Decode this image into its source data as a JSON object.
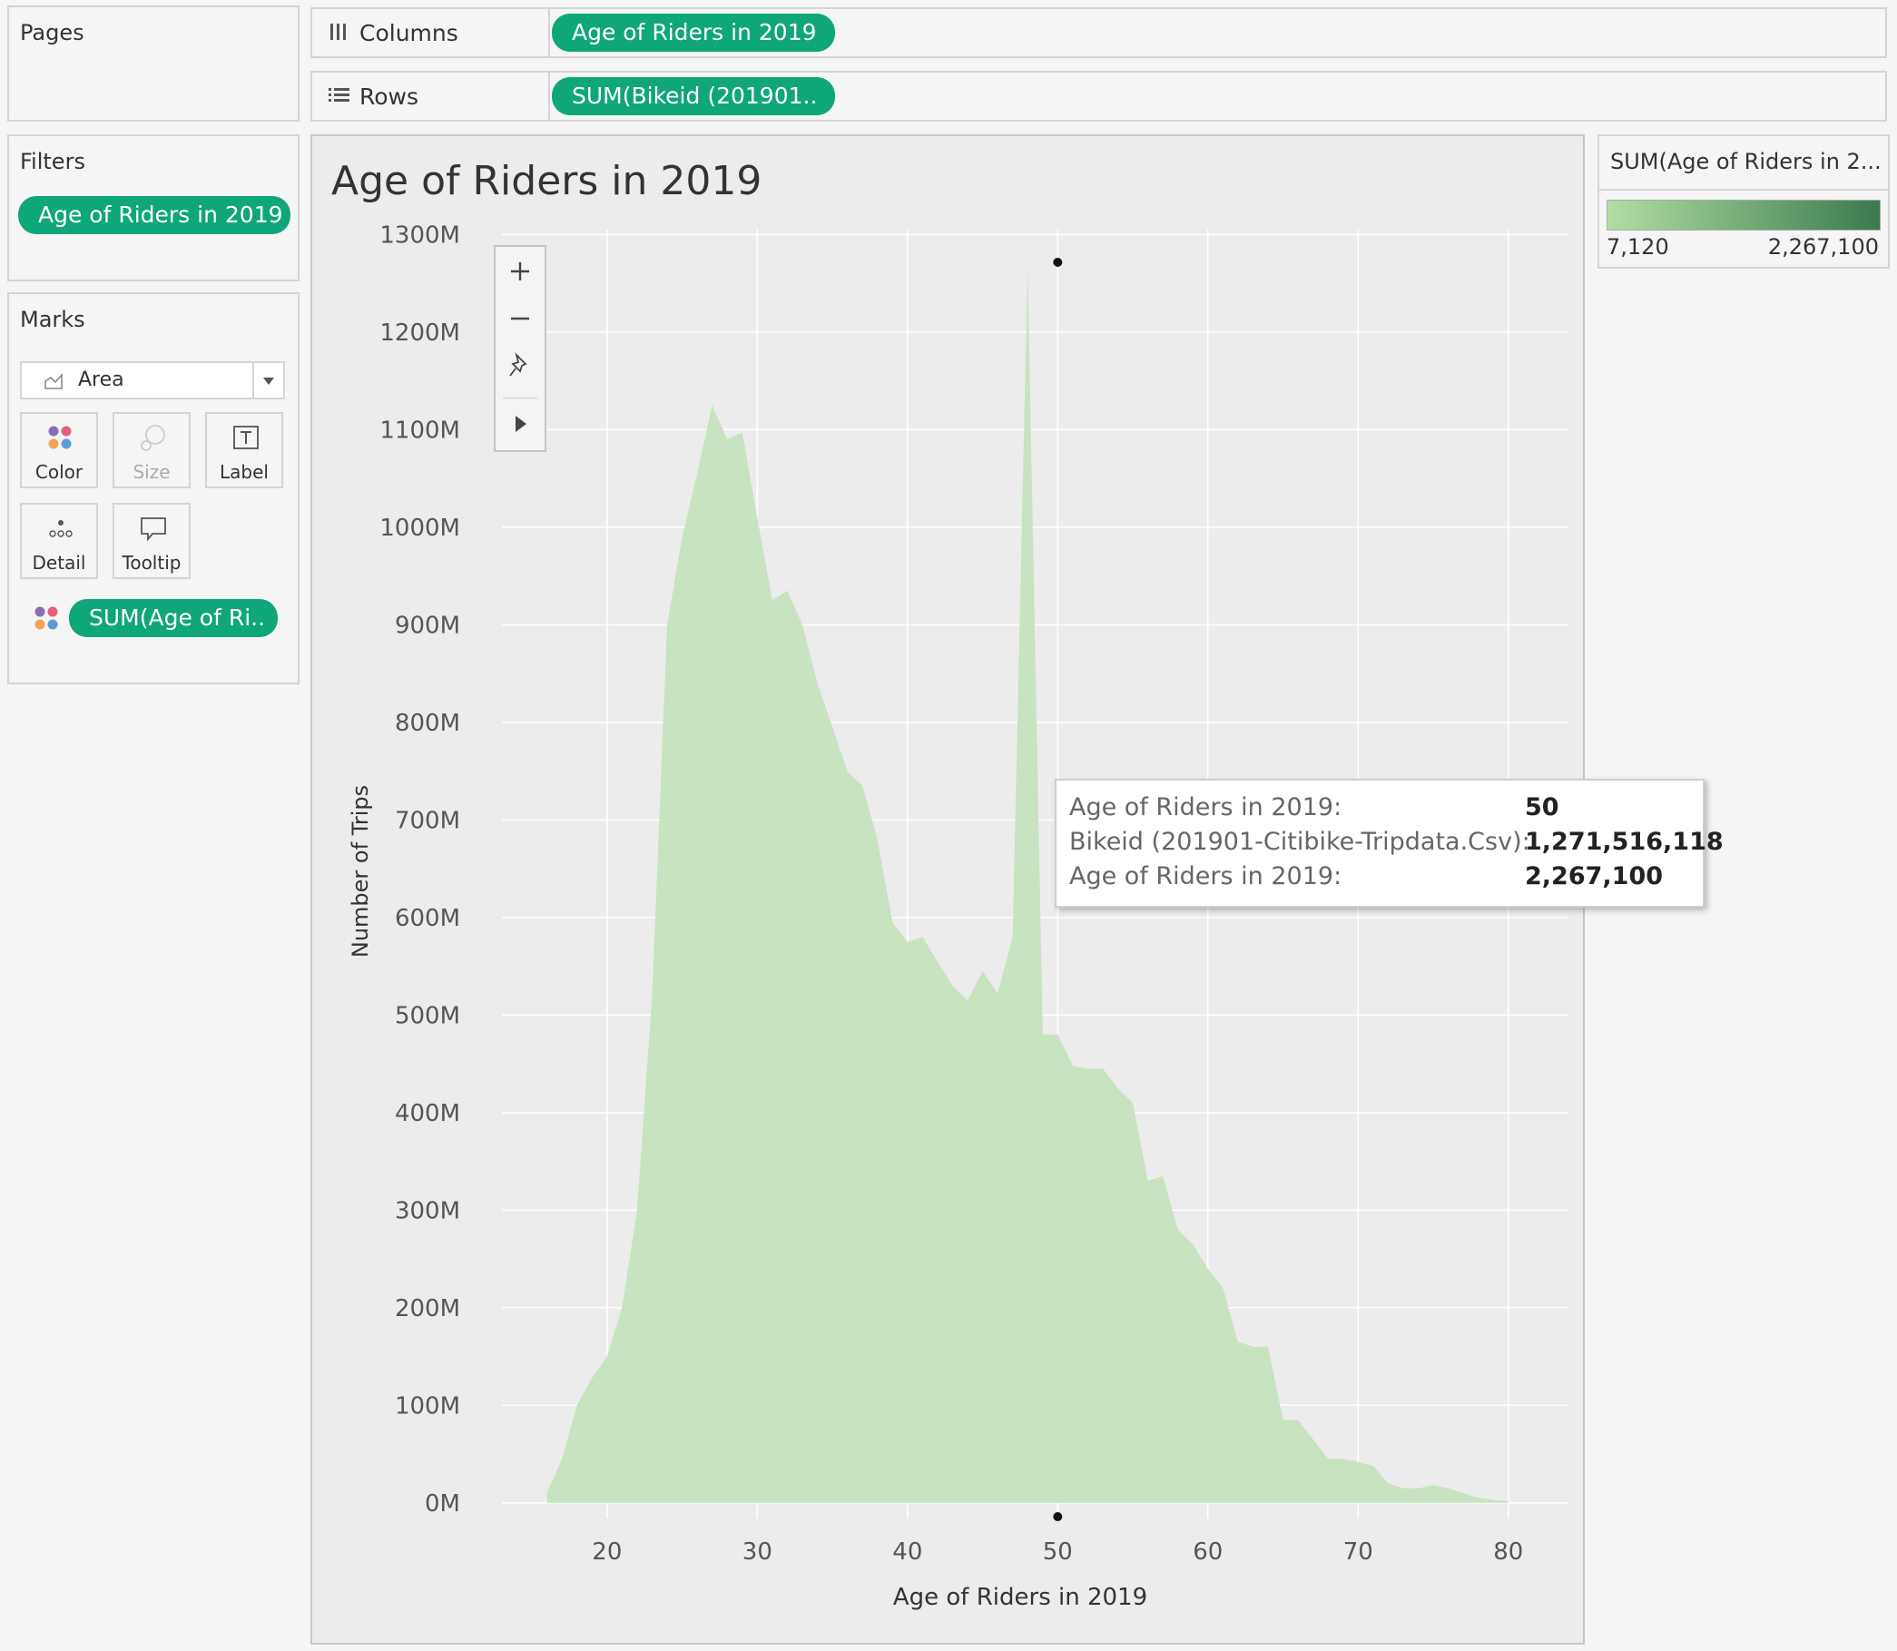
{
  "pages": {
    "title": "Pages"
  },
  "shelves": {
    "columns": {
      "label": "Columns",
      "pill": "Age of Riders in 2019"
    },
    "rows": {
      "label": "Rows",
      "pill": "SUM(Bikeid (201901.."
    }
  },
  "filters": {
    "title": "Filters",
    "pill": "Age of Riders in 2019"
  },
  "marks": {
    "title": "Marks",
    "type": "Area",
    "buttons": {
      "color": "Color",
      "size": "Size",
      "label": "Label",
      "detail": "Detail",
      "tooltip": "Tooltip"
    },
    "color_pill": "SUM(Age of Ri.."
  },
  "legend": {
    "title": "SUM(Age of Riders in 2...",
    "min_label": "7,120",
    "max_label": "2,267,100",
    "colors": {
      "low": "#b2dea3",
      "high": "#3a7a4e"
    }
  },
  "tooltip": {
    "rows": [
      {
        "key": "Age of Riders in 2019:",
        "value": "50"
      },
      {
        "key": "Bikeid (201901-Citibike-Tripdata.Csv):",
        "value": "1,271,516,118"
      },
      {
        "key": "Age of Riders in 2019:",
        "value": "2,267,100"
      }
    ]
  },
  "colors": {
    "pill": "#0fa67a",
    "area": "#c7e3c0"
  },
  "chart_data": {
    "type": "area",
    "title": "Age of Riders in 2019",
    "xlabel": "Age of Riders in 2019",
    "ylabel": "Number of Trips",
    "xlim": [
      13,
      84
    ],
    "ylim": [
      -16,
      1305
    ],
    "x_ticks": [
      20,
      30,
      40,
      50,
      60,
      70,
      80
    ],
    "y_ticks": [
      0,
      100,
      200,
      300,
      400,
      500,
      600,
      700,
      800,
      900,
      1000,
      1100,
      1200,
      1300
    ],
    "y_tick_labels": [
      "0M",
      "100M",
      "200M",
      "300M",
      "400M",
      "500M",
      "600M",
      "700M",
      "800M",
      "900M",
      "1000M",
      "1100M",
      "1200M",
      "1300M"
    ],
    "grid": true,
    "highlighted_point": {
      "x": 50,
      "y": 1271.5
    },
    "series": [
      {
        "unit": "M",
        "x": [
          16,
          17,
          18,
          19,
          20,
          21,
          22,
          23,
          24,
          25,
          26,
          27,
          28,
          29,
          30,
          31,
          32,
          33,
          34,
          35,
          36,
          37,
          38,
          39,
          40,
          41,
          42,
          43,
          44,
          45,
          46,
          47,
          48,
          49,
          50,
          51,
          52,
          53,
          54,
          55,
          56,
          57,
          58,
          59,
          60,
          61,
          62,
          63,
          64,
          65,
          66,
          67,
          68,
          69,
          70,
          71,
          72,
          73,
          74,
          75,
          76,
          77,
          78,
          79,
          80
        ],
        "y": [
          10,
          45,
          100,
          128,
          150,
          200,
          300,
          520,
          900,
          990,
          1055,
          1125,
          1090,
          1097,
          1010,
          925,
          935,
          900,
          840,
          795,
          750,
          735,
          680,
          595,
          575,
          580,
          555,
          530,
          515,
          545,
          522,
          580,
          1265,
          480,
          480,
          448,
          445,
          445,
          425,
          410,
          330,
          335,
          280,
          265,
          240,
          220,
          165,
          160,
          160,
          85,
          85,
          65,
          45,
          45,
          42,
          38,
          20,
          15,
          15,
          18,
          15,
          10,
          5,
          3,
          2
        ]
      }
    ]
  }
}
